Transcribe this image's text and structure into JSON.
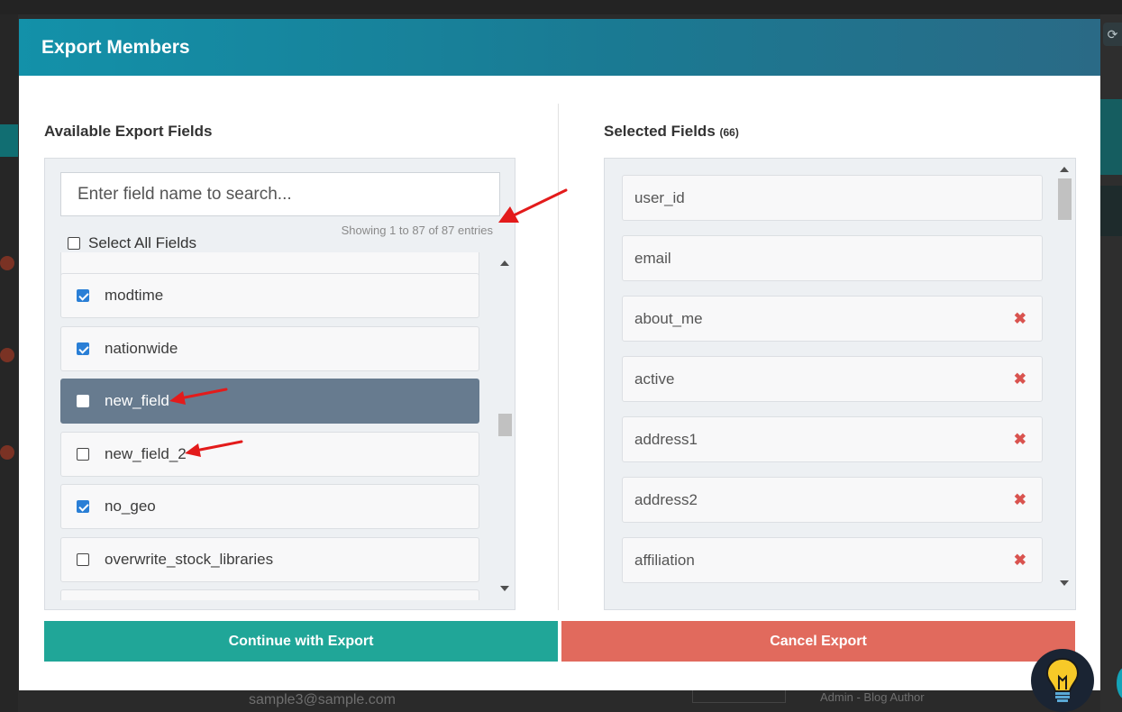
{
  "modal": {
    "title": "Export Members"
  },
  "available": {
    "title": "Available Export Fields",
    "search_placeholder": "Enter field name to search...",
    "showing_text": "Showing 1 to 87 of 87 entries",
    "select_all_label": "Select All Fields",
    "items": [
      {
        "label": "modtime",
        "checked": true
      },
      {
        "label": "nationwide",
        "checked": true
      },
      {
        "label": "new_field",
        "checked": false,
        "highlighted": true
      },
      {
        "label": "new_field_2",
        "checked": false
      },
      {
        "label": "no_geo",
        "checked": true
      },
      {
        "label": "overwrite_stock_libraries",
        "checked": false
      }
    ]
  },
  "selected": {
    "title": "Selected Fields",
    "count": "(66)",
    "items": [
      {
        "label": "user_id",
        "removable": false
      },
      {
        "label": "email",
        "removable": false
      },
      {
        "label": "about_me",
        "removable": true
      },
      {
        "label": "active",
        "removable": true
      },
      {
        "label": "address1",
        "removable": true
      },
      {
        "label": "address2",
        "removable": true
      },
      {
        "label": "affiliation",
        "removable": true
      }
    ],
    "remove_glyph": "✖"
  },
  "buttons": {
    "continue": "Continue with Export",
    "cancel": "Cancel Export"
  },
  "background": {
    "email": "sample3@sample.com",
    "author": "Admin - Blog Author"
  },
  "colors": {
    "header": "#1391a9",
    "continue": "#20a698",
    "cancel": "#e16a5d",
    "highlight_row": "#677b8f",
    "annotation_arrow": "#e31b1b"
  }
}
